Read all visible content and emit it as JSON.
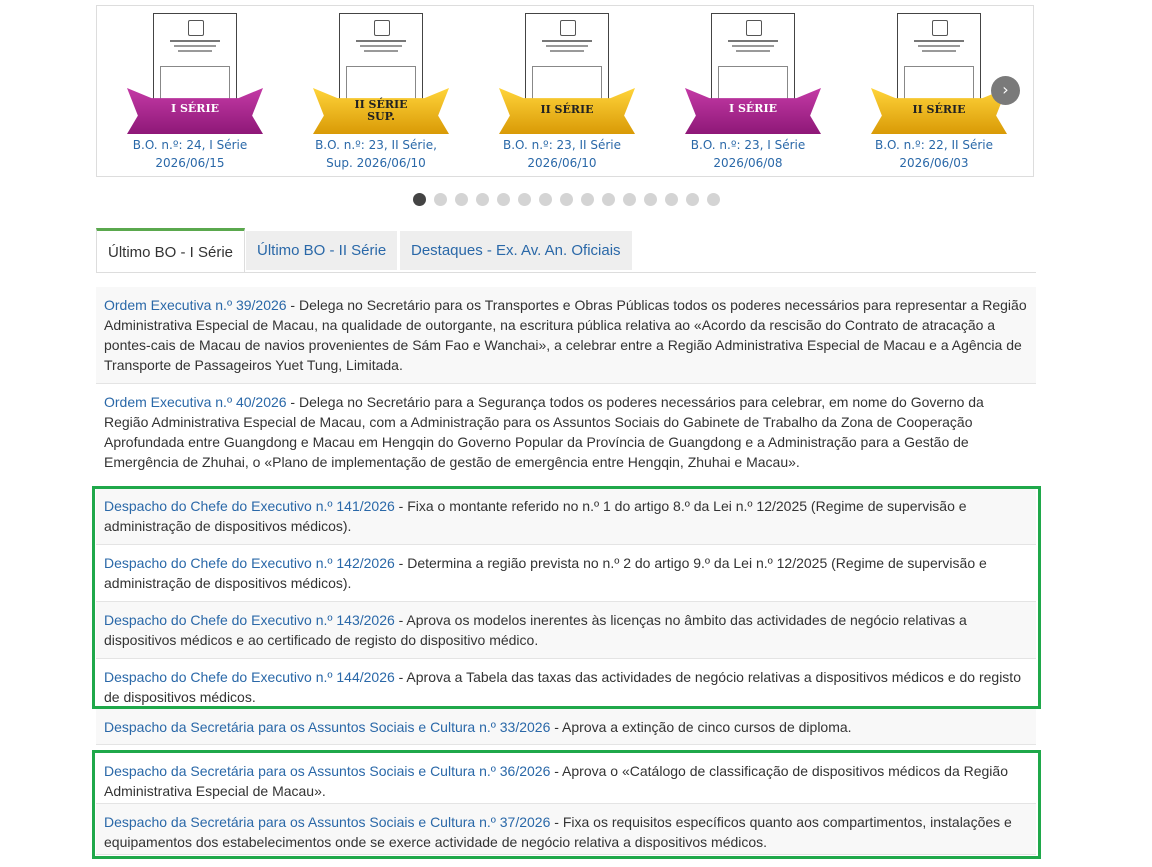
{
  "carousel": {
    "slides": [
      {
        "ribbon": "I SÉRIE",
        "color": "pink",
        "caption": "B.O. n.º: 24, I Série 2026/06/15"
      },
      {
        "ribbon": "II SÉRIE SUP.",
        "color": "gold",
        "caption": "B.O. n.º: 23, II Série, Sup. 2026/06/10"
      },
      {
        "ribbon": "II SÉRIE",
        "color": "gold",
        "caption": "B.O. n.º: 23, II Série 2026/06/10"
      },
      {
        "ribbon": "I SÉRIE",
        "color": "pink",
        "caption": "B.O. n.º: 23, I Série 2026/06/08"
      },
      {
        "ribbon": "II SÉRIE",
        "color": "gold",
        "caption": "B.O. n.º: 22, II Série 2026/06/03"
      }
    ],
    "next_icon": "chevron-right-icon",
    "dot_count": 15,
    "active_dot": 0
  },
  "tabs": [
    {
      "label": "Último BO - I Série",
      "active": true
    },
    {
      "label": "Último BO - II Série",
      "active": false
    },
    {
      "label": "Destaques - Ex. Av. An. Oficiais",
      "active": false
    }
  ],
  "entries": [
    {
      "title": "Ordem Executiva n.º 39/2026",
      "desc": " - Delega no Secretário para os Transportes e Obras Públicas todos os poderes necessários para representar a Região Administrativa Especial de Macau, na qualidade de outorgante, na escritura pública relativa ao «Acordo da rescisão do Contrato de atracação a pontes-cais de Macau de navios provenientes de Sám Fao e Wanchai», a celebrar entre a Região Administrativa Especial de Macau e a Agência de Transporte de Passageiros Yuet Tung, Limitada."
    },
    {
      "title": "Ordem Executiva n.º 40/2026",
      "desc": " - Delega no Secretário para a Segurança todos os poderes necessários para celebrar, em nome do Governo da Região Administrativa Especial de Macau, com a Administração para os Assuntos Sociais do Gabinete de Trabalho da Zona de Cooperação Aprofundada entre Guangdong e Macau em Hengqin do Governo Popular da Província de Guangdong e a Administração para a Gestão de Emergência de Zhuhai, o «Plano de implementação de gestão de emergência entre Hengqin, Zhuhai e Macau»."
    },
    {
      "title": "Despacho do Chefe do Executivo n.º 141/2026",
      "desc": " - Fixa o montante referido no n.º 1 do artigo 8.º da Lei n.º 12/2025 (Regime de supervisão e administração de dispositivos médicos)."
    },
    {
      "title": "Despacho do Chefe do Executivo n.º 142/2026",
      "desc": " - Determina a região prevista no n.º 2 do artigo 9.º da Lei n.º 12/2025 (Regime de supervisão e administração de dispositivos médicos)."
    },
    {
      "title": "Despacho do Chefe do Executivo n.º 143/2026",
      "desc": " - Aprova os modelos inerentes às licenças no âmbito das actividades de negócio relativas a dispositivos médicos e ao certificado de registo do dispositivo médico."
    },
    {
      "title": "Despacho do Chefe do Executivo n.º 144/2026",
      "desc": " - Aprova a Tabela das taxas das actividades de negócio relativas a dispositivos médicos e do registo de dispositivos médicos."
    },
    {
      "title": "Despacho da Secretária para os Assuntos Sociais e Cultura n.º 33/2026",
      "desc": " - Aprova a extinção de cinco cursos de diploma."
    },
    {
      "title": "Despacho da Secretária para os Assuntos Sociais e Cultura n.º 36/2026",
      "desc": " - Aprova o «Catálogo de classificação de dispositivos médicos da Região Administrativa Especial de Macau»."
    },
    {
      "title": "Despacho da Secretária para os Assuntos Sociais e Cultura n.º 37/2026",
      "desc": " - Fixa os requisitos específicos quanto aos compartimentos, instalações e equipamentos dos estabelecimentos onde se exerce actividade de negócio relativa a dispositivos médicos."
    }
  ],
  "highlight_color": "#1fa84a",
  "link_color": "#2a68a8"
}
